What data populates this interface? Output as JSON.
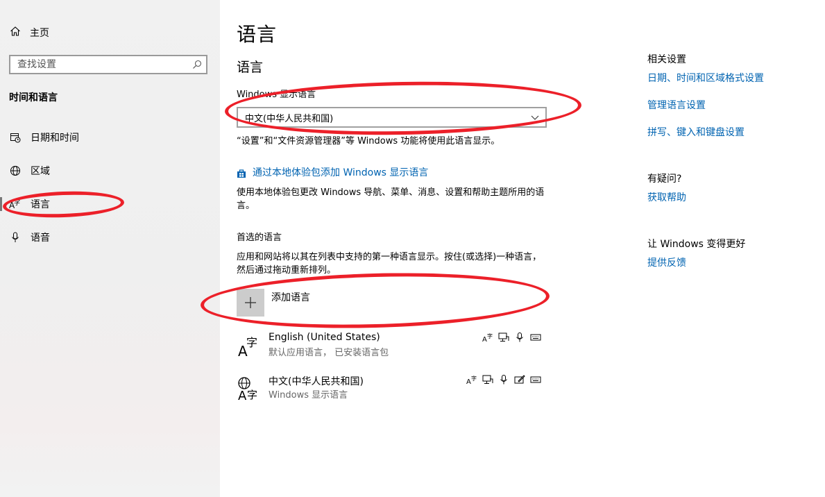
{
  "sidebar": {
    "home_label": "主页",
    "search_placeholder": "查找设置",
    "section_title": "时间和语言",
    "items": [
      {
        "label": "日期和时间",
        "icon": "calendar-clock-icon"
      },
      {
        "label": "区域",
        "icon": "globe-icon"
      },
      {
        "label": "语言",
        "icon": "language-icon"
      },
      {
        "label": "语音",
        "icon": "microphone-icon"
      }
    ]
  },
  "main": {
    "title": "语言",
    "section_heading": "语言",
    "display_language_label": "Windows 显示语言",
    "display_language_value": "中文(中华人民共和国)",
    "display_language_desc": "“设置”和“文件资源管理器”等 Windows 功能将使用此语言显示。",
    "add_local_pack_link": "通过本地体验包添加 Windows 显示语言",
    "local_pack_desc": "使用本地体验包更改 Windows 导航、菜单、消息、设置和帮助主题所用的语言。",
    "preferred_heading": "首选的语言",
    "preferred_desc": "应用和网站将以其在列表中支持的第一种语言显示。按住(或选择)一种语言，然后通过拖动重新排列。",
    "add_language_label": "添加语言",
    "languages": [
      {
        "name": "English (United States)",
        "subtitle": "默认应用语言， 已安装语言包"
      },
      {
        "name": "中文(中华人民共和国)",
        "subtitle": "Windows 显示语言"
      }
    ]
  },
  "right": {
    "related_heading": "相关设置",
    "related_links": [
      "日期、时间和区域格式设置",
      "管理语言设置",
      "拼写、键入和键盘设置"
    ],
    "question_heading": "有疑问?",
    "help_link": "获取帮助",
    "improve_heading": "让 Windows 变得更好",
    "feedback_link": "提供反馈"
  },
  "colors": {
    "accent": "#0063b1",
    "annotation": "#ec2029"
  }
}
